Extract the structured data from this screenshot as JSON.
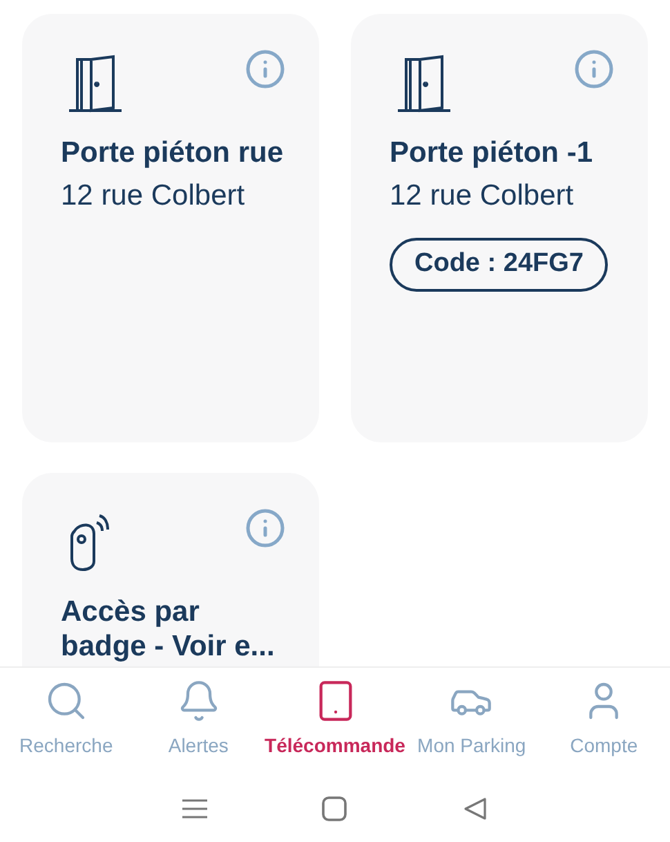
{
  "cards": [
    {
      "kind": "door",
      "title": "Porte piéton rue",
      "address": "12 rue Colbert"
    },
    {
      "kind": "door",
      "title": "Porte piéton -1",
      "address": "12 rue Colbert",
      "code": "Code : 24FG7"
    },
    {
      "kind": "badge",
      "title": "Accès par badge - Voir e..."
    }
  ],
  "nav": [
    {
      "kind": "search",
      "label": "Recherche",
      "selected": false
    },
    {
      "kind": "alerts",
      "label": "Alertes",
      "selected": false
    },
    {
      "kind": "remote",
      "label": "Télécommande",
      "selected": true
    },
    {
      "kind": "parking",
      "label": "Mon Parking",
      "selected": false
    },
    {
      "kind": "account",
      "label": "Compte",
      "selected": false
    }
  ]
}
